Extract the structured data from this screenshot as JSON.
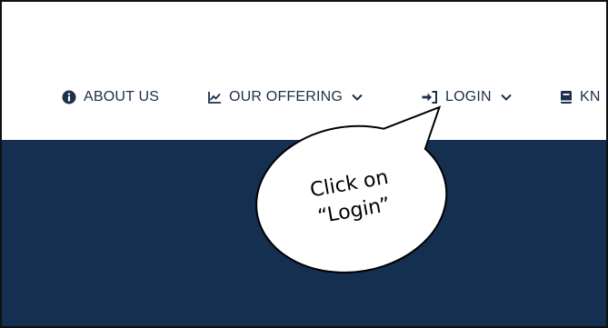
{
  "nav": {
    "items": [
      {
        "label": "ABOUT US",
        "icon": "info-circle-icon"
      },
      {
        "label": "OUR OFFERING",
        "icon": "line-chart-icon",
        "dropdown": true
      },
      {
        "label": "LOGIN",
        "icon": "sign-in-icon",
        "dropdown": true
      },
      {
        "label": "KN",
        "icon": "book-icon"
      }
    ]
  },
  "callout": {
    "line1": "Click on",
    "line2": "“Login”"
  },
  "colors": {
    "nav_text": "#1d2f4a",
    "hero_background": "#142f4f",
    "bubble_fill": "#ffffff",
    "bubble_stroke": "#000000"
  }
}
